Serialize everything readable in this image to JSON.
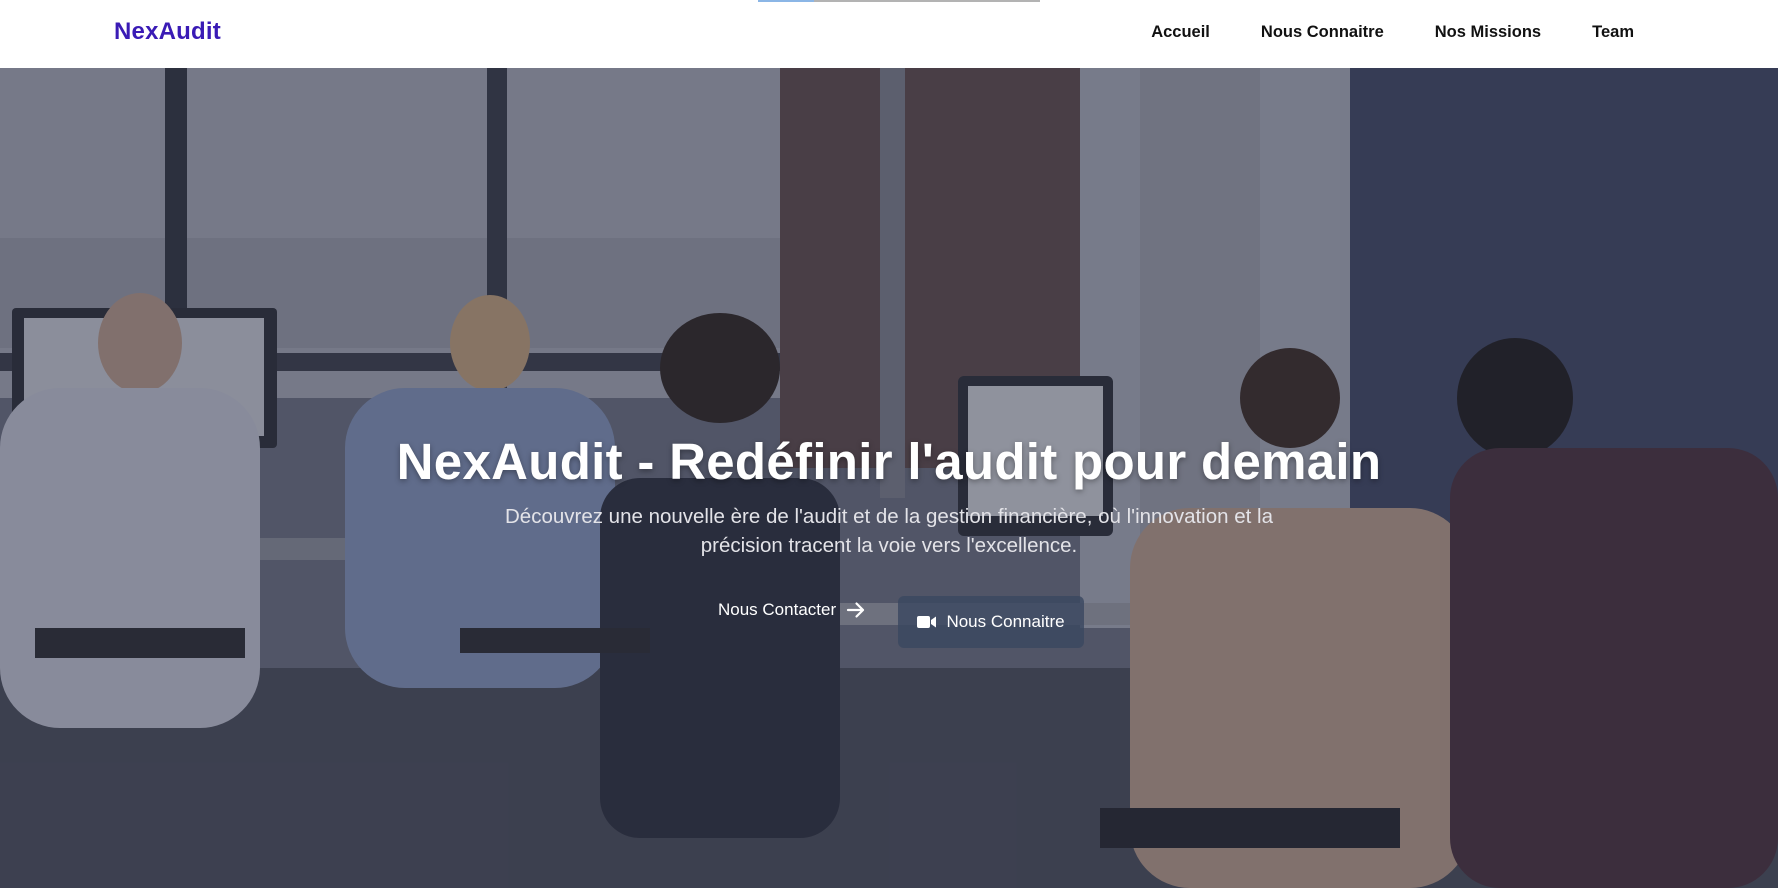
{
  "brand": {
    "name": "NexAudit",
    "color": "#3a1bb5"
  },
  "nav": {
    "items": [
      {
        "label": "Accueil"
      },
      {
        "label": "Nous Connaitre"
      },
      {
        "label": "Nos Missions"
      },
      {
        "label": "Team"
      }
    ]
  },
  "scroll_progress": {
    "fraction": 0.2
  },
  "hero": {
    "title": "NexAudit - Redéfinir l'audit pour demain",
    "subtitle": "Découvrez une nouvelle ère de l'audit et de la gestion financière, où l'innovation et la précision tracent la voie vers l'excellence.",
    "primary_button": {
      "label": "Nous Contacter",
      "icon": "arrow-right-icon"
    },
    "secondary_button": {
      "label": "Nous Connaitre",
      "icon": "video-camera-icon"
    },
    "background": "office-photo"
  },
  "colors": {
    "overlay": "#282c42",
    "button_bg": "#3a4860",
    "text": "#ffffff"
  }
}
